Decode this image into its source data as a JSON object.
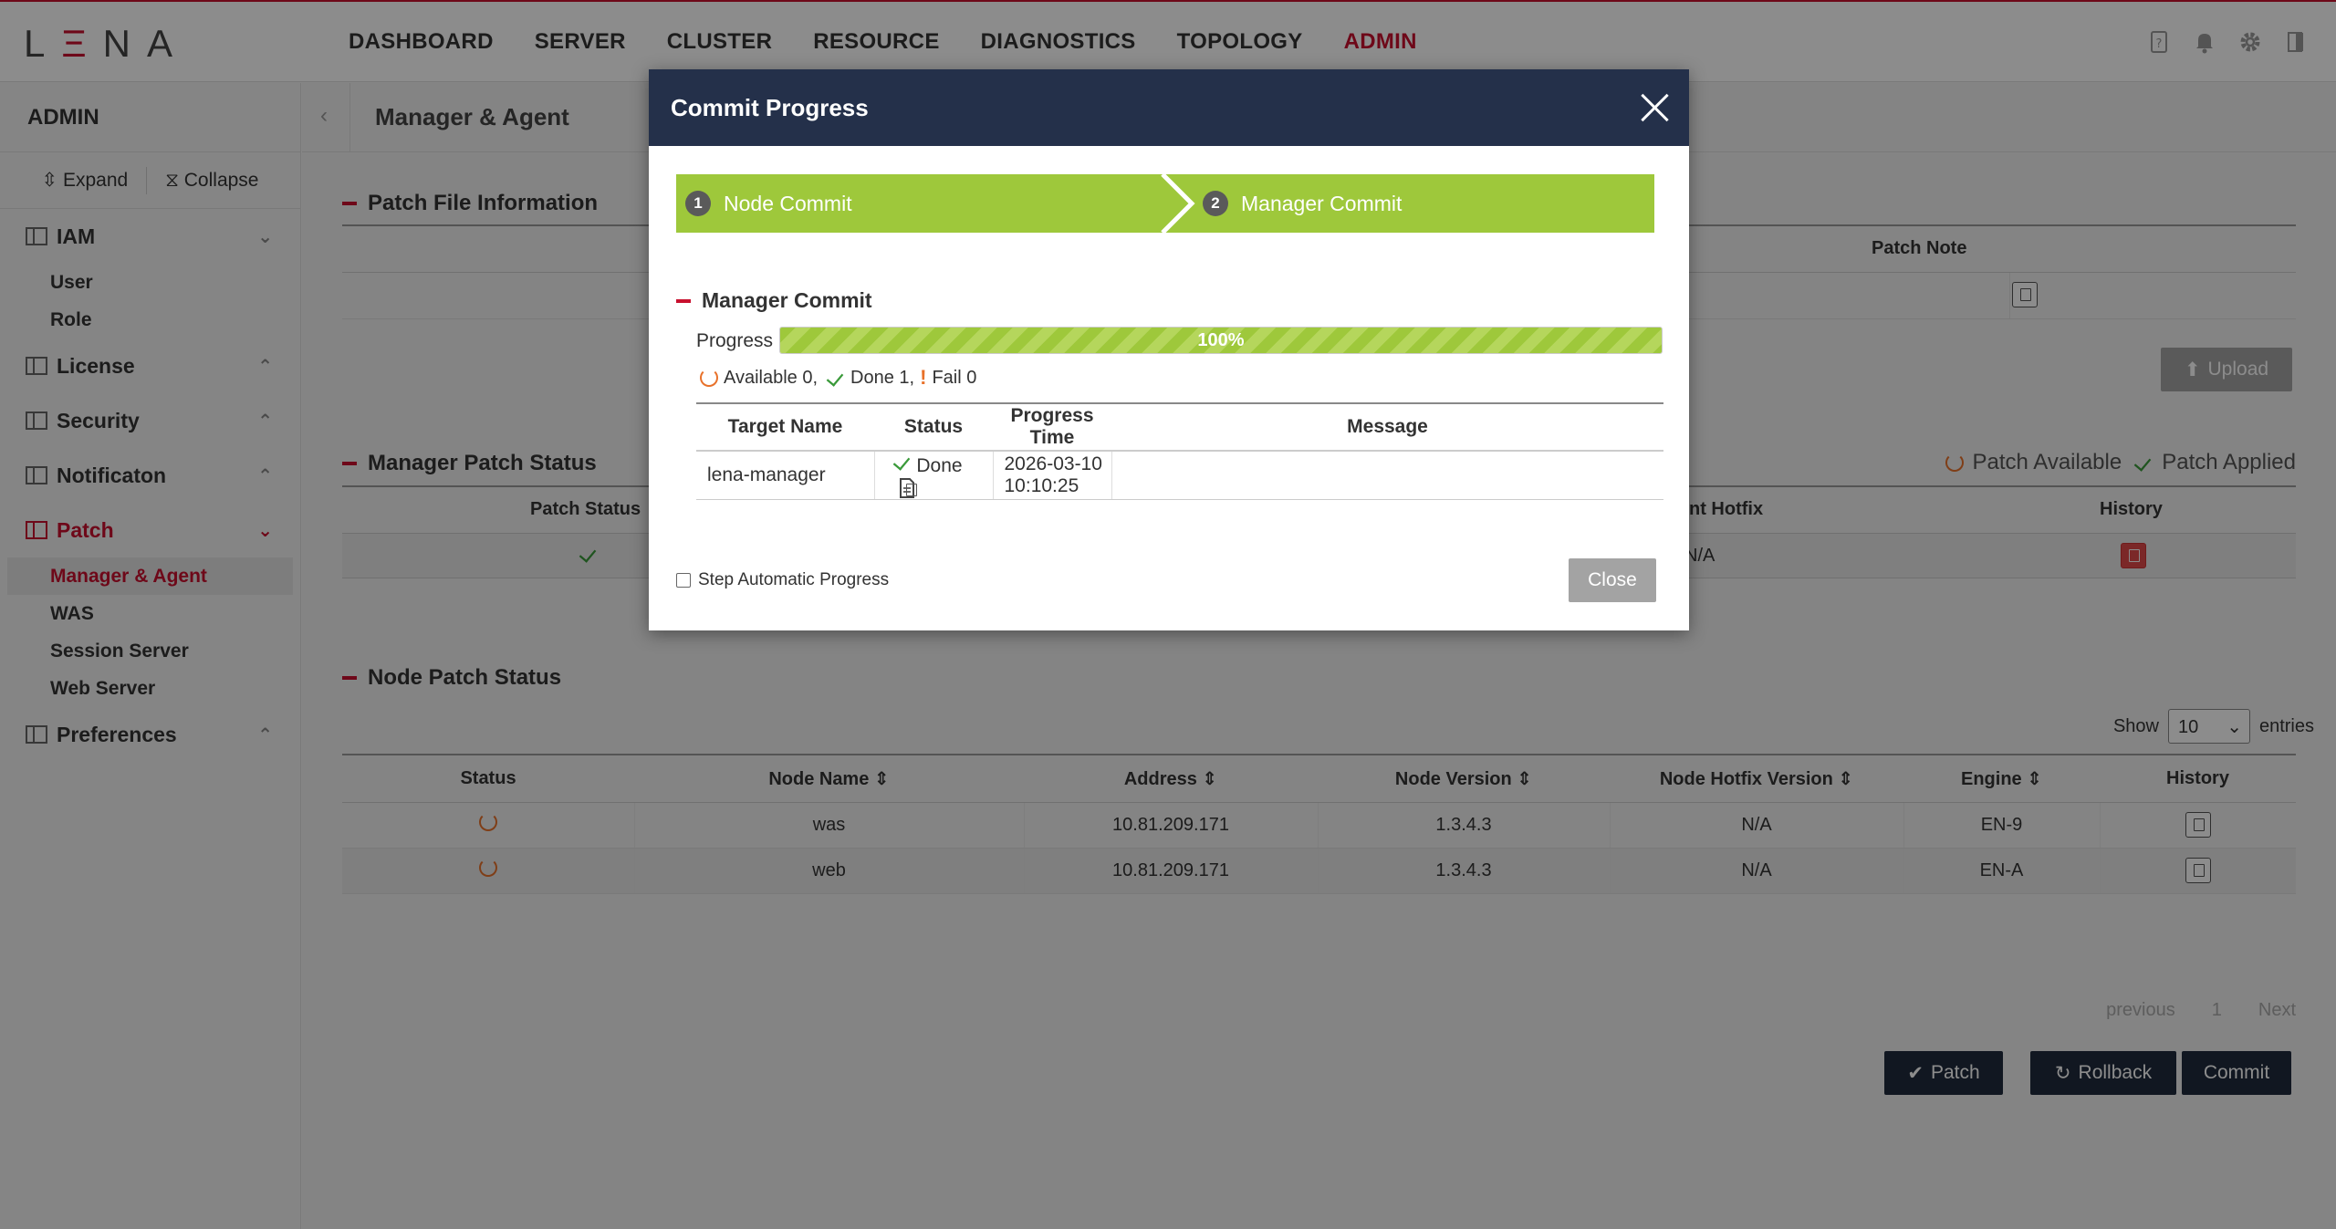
{
  "app": {
    "logo": "LENA",
    "nav": [
      "DASHBOARD",
      "SERVER",
      "CLUSTER",
      "RESOURCE",
      "DIAGNOSTICS",
      "TOPOLOGY",
      "ADMIN"
    ],
    "active_nav": "ADMIN",
    "icons": [
      "help-icon",
      "bell-icon",
      "gear-icon",
      "logout-icon"
    ]
  },
  "sidebar": {
    "title": "ADMIN",
    "expand_label": "Expand",
    "collapse_label": "Collapse",
    "groups": [
      {
        "label": "IAM",
        "items": [
          "User",
          "Role"
        ]
      },
      {
        "label": "License",
        "items": []
      },
      {
        "label": "Security",
        "items": []
      },
      {
        "label": "Notificaton",
        "items": []
      },
      {
        "label": "Patch",
        "items": [
          "Manager & Agent",
          "WAS",
          "Session Server",
          "Web Server"
        ]
      },
      {
        "label": "Preferences",
        "items": []
      }
    ]
  },
  "page": {
    "title": "Manager & Agent",
    "patch_file_section": "Patch File Information",
    "patch_note_header": "Patch Note",
    "upload_label": "Upload",
    "manager_patch_section": "Manager Patch Status",
    "legend_available": "Patch Available",
    "legend_applied": "Patch Applied",
    "manager_headers": [
      "Patch Status",
      "nt Hotfix",
      "History"
    ],
    "manager_row": {
      "hotfix": "N/A"
    },
    "node_section": "Node Patch Status",
    "show_label": "Show",
    "show_value": "10",
    "entries_label": "entries",
    "node_headers": [
      "Status",
      "Node Name",
      "Address",
      "Node Version",
      "Node Hotfix Version",
      "Engine",
      "History"
    ],
    "node_rows": [
      {
        "name": "was",
        "address": "10.81.209.171",
        "version": "1.3.4.3",
        "hotfix": "N/A",
        "engine": "EN-9"
      },
      {
        "name": "web",
        "address": "10.81.209.171",
        "version": "1.3.4.3",
        "hotfix": "N/A",
        "engine": "EN-A"
      }
    ],
    "pager": {
      "previous": "previous",
      "page": "1",
      "next": "Next"
    },
    "buttons": {
      "patch": "Patch",
      "rollback": "Rollback",
      "commit": "Commit"
    }
  },
  "modal": {
    "title": "Commit Progress",
    "steps": [
      {
        "num": "1",
        "label": "Node Commit"
      },
      {
        "num": "2",
        "label": "Manager Commit"
      }
    ],
    "section_title": "Manager Commit",
    "progress_label": "Progress",
    "progress_value": 100,
    "progress_text": "100%",
    "available_text": "Available 0,",
    "done_text": "Done 1,",
    "fail_text": "Fail 0",
    "table_headers": [
      "Target Name",
      "Status",
      "Progress Time",
      "Message"
    ],
    "rows": [
      {
        "target": "lena-manager",
        "status": "Done",
        "time": "2026-03-10 10:10:25",
        "message": ""
      }
    ],
    "auto_label": "Step Automatic Progress",
    "close_label": "Close"
  },
  "colors": {
    "brand_red": "#c8102e",
    "navy": "#24304a",
    "green": "#9ec83b",
    "orange": "#e8712a"
  }
}
